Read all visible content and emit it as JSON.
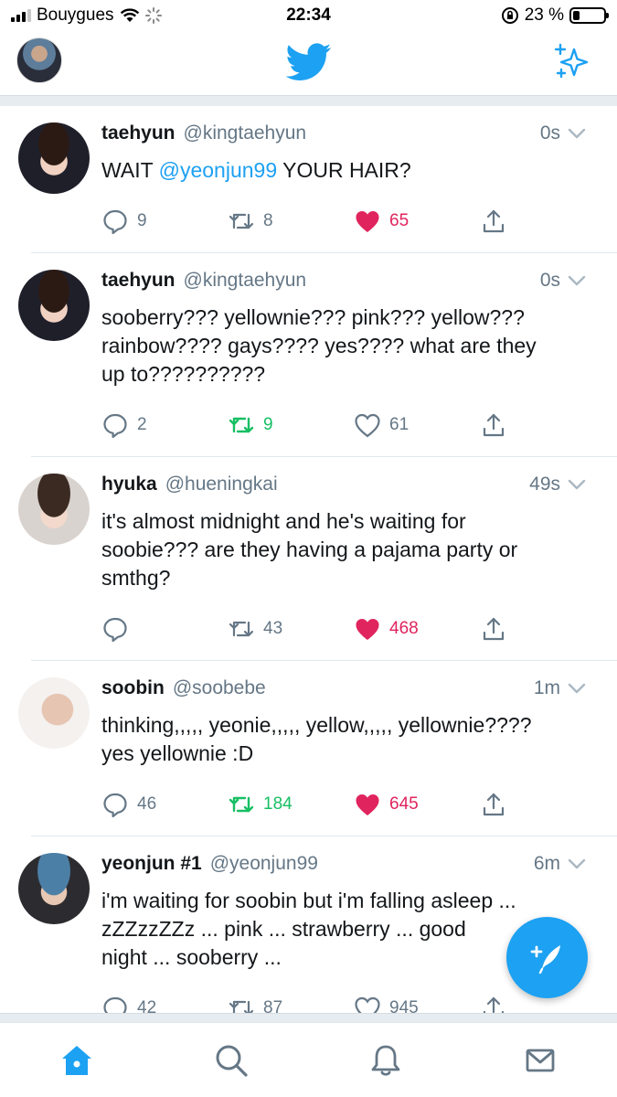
{
  "status_bar": {
    "carrier": "Bouygues",
    "time": "22:34",
    "battery_percent": "23 %",
    "battery_level": 0.23
  },
  "nav": {
    "logo_icon": "twitter-bird-icon",
    "sparkle_icon": "sparkle-icon"
  },
  "colors": {
    "accent": "#1da1f2",
    "retweet": "#17bf63",
    "like": "#e0245e",
    "secondary_text": "#657786"
  },
  "tweets": [
    {
      "name": "taehyun",
      "handle": "@kingtaehyun",
      "time": "0s",
      "text_pre": "WAIT ",
      "mention": "@yeonjun99",
      "text_post": " YOUR HAIR?",
      "replies": "9",
      "retweets": "8",
      "likes": "65",
      "retweeted": false,
      "liked": true
    },
    {
      "name": "taehyun",
      "handle": "@kingtaehyun",
      "time": "0s",
      "text": "sooberry??? yellownie??? pink??? yellow???\nrainbow???? gays???? yes???? what are they\nup to??????????",
      "replies": "2",
      "retweets": "9",
      "likes": "61",
      "retweeted": true,
      "liked": false
    },
    {
      "name": "hyuka",
      "handle": "@hueningkai",
      "time": "49s",
      "text": "it's almost midnight and he's waiting for\nsoobie??? are they having a pajama party or\nsmthg?",
      "replies": "",
      "retweets": "43",
      "likes": "468",
      "retweeted": false,
      "liked": true
    },
    {
      "name": "soobin",
      "handle": "@soobebe",
      "time": "1m",
      "text": "thinking,,,,, yeonie,,,,, yellow,,,,, yellownie????\nyes yellownie :D",
      "replies": "46",
      "retweets": "184",
      "likes": "645",
      "retweeted": true,
      "liked": true
    },
    {
      "name": "yeonjun #1",
      "handle": "@yeonjun99",
      "time": "6m",
      "text": "i'm waiting for soobin but i'm falling asleep ...\nzZZzzZZz ... pink ... strawberry ... good\nnight ... sooberry ...",
      "replies": "42",
      "retweets": "87",
      "likes": "945",
      "retweeted": false,
      "liked": false
    }
  ],
  "fab_icon": "compose-tweet-icon",
  "tabbar": [
    "home-icon",
    "search-icon",
    "notifications-icon",
    "messages-icon"
  ]
}
